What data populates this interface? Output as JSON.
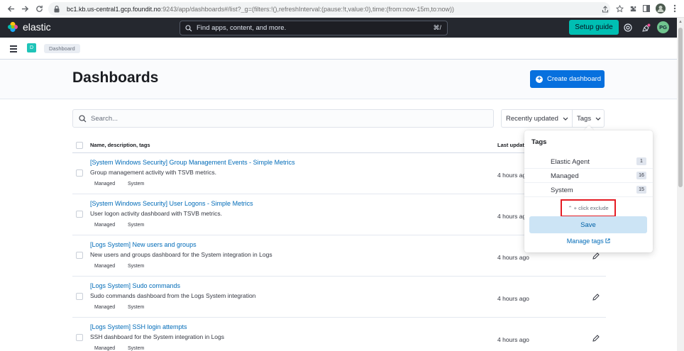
{
  "browser": {
    "url_host": "bc1.kb.us-central1.gcp.foundit.no",
    "url_rest": ":9243/app/dashboards#/list?_g=(filters:!(),refreshInterval:(pause:!t,value:0),time:(from:now-15m,to:now))",
    "profile_initials": "PG"
  },
  "header": {
    "brand": "elastic",
    "search_placeholder": "Find apps, content, and more.",
    "search_shortcut": "⌘/",
    "setup_guide": "Setup guide",
    "avatar": "PG"
  },
  "breadcrumbs": {
    "space": "D",
    "items": [
      "Dashboard"
    ]
  },
  "page": {
    "title": "Dashboards",
    "create_button": "Create dashboard"
  },
  "toolbar": {
    "search_placeholder": "Search...",
    "sort_label": "Recently updated",
    "tags_label": "Tags"
  },
  "table": {
    "columns": [
      "Name, description, tags",
      "Last updated"
    ],
    "rows": [
      {
        "title": "[System Windows Security] Group Management Events - Simple Metrics",
        "description": "Group management activity with TSVB metrics.",
        "tags": [
          "Managed",
          "System"
        ],
        "updated": "4 hours ago"
      },
      {
        "title": "[System Windows Security] User Logons - Simple Metrics",
        "description": "User logon activity dashboard with TSVB metrics.",
        "tags": [
          "Managed",
          "System"
        ],
        "updated": "4 hours ago"
      },
      {
        "title": "[Logs System] New users and groups",
        "description": "New users and groups dashboard for the System integration in Logs",
        "tags": [
          "Managed",
          "System"
        ],
        "updated": "4 hours ago"
      },
      {
        "title": "[Logs System] Sudo commands",
        "description": "Sudo commands dashboard from the Logs System integration",
        "tags": [
          "Managed",
          "System"
        ],
        "updated": "4 hours ago"
      },
      {
        "title": "[Logs System] SSH login attempts",
        "description": "SSH dashboard for the System integration in Logs",
        "tags": [
          "Managed",
          "System"
        ],
        "updated": "4 hours ago"
      }
    ]
  },
  "tags_popover": {
    "title": "Tags",
    "items": [
      {
        "label": "Elastic Agent",
        "count": "1"
      },
      {
        "label": "Managed",
        "count": "16"
      },
      {
        "label": "System",
        "count": "15"
      }
    ],
    "exclude_hint": "⌃ + click exclude",
    "save": "Save",
    "manage": "Manage tags"
  },
  "colors": {
    "accent": "#0770de",
    "setup": "#00bfb3",
    "header_bg": "#25282f",
    "highlight": "#e51b23"
  }
}
